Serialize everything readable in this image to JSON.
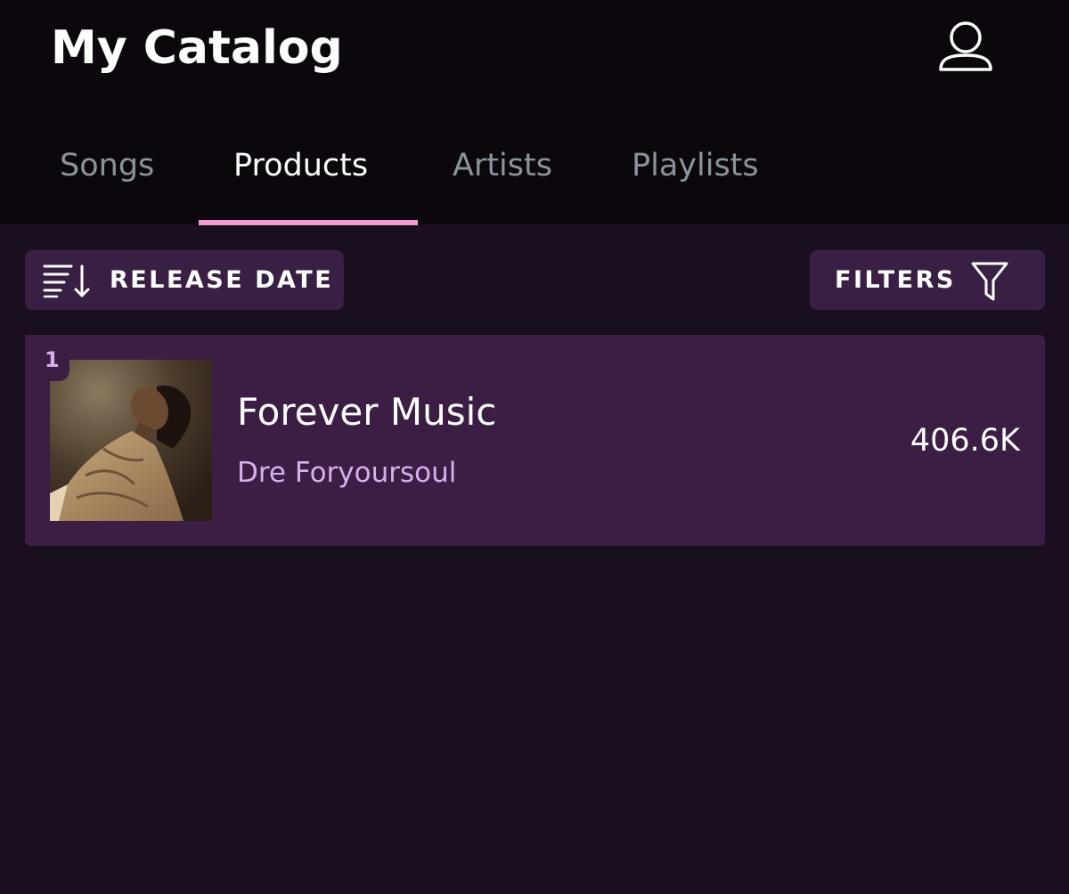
{
  "header": {
    "title": "My Catalog",
    "profile_icon": "user-icon"
  },
  "tabs": [
    {
      "label": "Songs",
      "active": false
    },
    {
      "label": "Products",
      "active": true
    },
    {
      "label": "Artists",
      "active": false
    },
    {
      "label": "Playlists",
      "active": false
    }
  ],
  "toolbar": {
    "sort_label": "RELEASE DATE",
    "sort_icon": "sort-descending-icon",
    "filters_label": "FILTERS",
    "filters_icon": "filter-funnel-icon"
  },
  "products": [
    {
      "rank": "1",
      "title": "Forever Music",
      "artist": "Dre Foryoursoul",
      "count": "406.6K",
      "cover_icon": "album-cover-image"
    }
  ],
  "colors": {
    "background": "#1a0f1e",
    "header_background": "#0b070d",
    "card_background": "#3c1d44",
    "button_background": "#3a1f44",
    "tab_indicator": "#f29bd4",
    "inactive_tab": "#8b949c",
    "accent_text": "#d7b0ea"
  }
}
